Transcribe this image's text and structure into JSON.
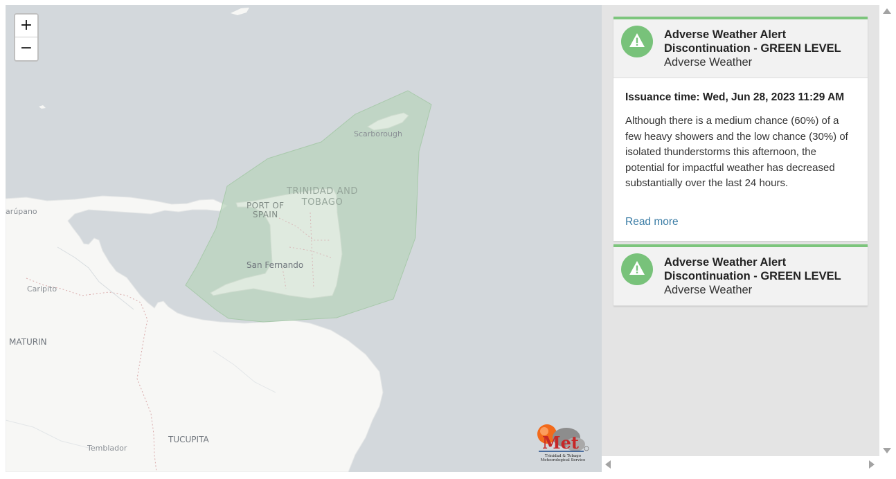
{
  "map": {
    "zoom_in_label": "+",
    "zoom_out_label": "−",
    "labels": {
      "scarborough": "Scarborough",
      "trinidad_tobago_line1": "TRINIDAD AND",
      "trinidad_tobago_line2": "TOBAGO",
      "port_of_spain_line1": "PORT OF",
      "port_of_spain_line2": "SPAIN",
      "san_fernando": "San Fernando",
      "carupano": "arúpano",
      "caripito": "Caripito",
      "maturin": "MATURIN",
      "tucupita": "TUCUPITA",
      "temblador": "Temblador"
    },
    "alert_area_color": "#b9d4bc",
    "water_color": "#d3d8dc",
    "land_color": "#f7f7f5"
  },
  "logo": {
    "text": "Met",
    "caption_line1": "Trinidad & Tobago",
    "caption_line2": "Meteorological Service"
  },
  "alerts": [
    {
      "title": "Adverse Weather Alert Discontinuation - GREEN LEVEL",
      "subtitle": "Adverse Weather",
      "issuance_label": "Issuance time:",
      "issuance_value": "Wed, Jun 28, 2023 11:29 AM",
      "description": "Although there is a medium chance (60%) of a few heavy showers and the low chance (30%) of isolated thunderstorms this afternoon, the potential for impactful weather has decreased substantially over the last 24 hours.",
      "read_more": "Read more",
      "level_color": "#7cc57c",
      "icon": "warning-triangle-icon"
    },
    {
      "title": "Adverse Weather Alert Discontinuation - GREEN LEVEL",
      "subtitle": "Adverse Weather",
      "level_color": "#7cc57c",
      "icon": "warning-triangle-icon"
    }
  ]
}
